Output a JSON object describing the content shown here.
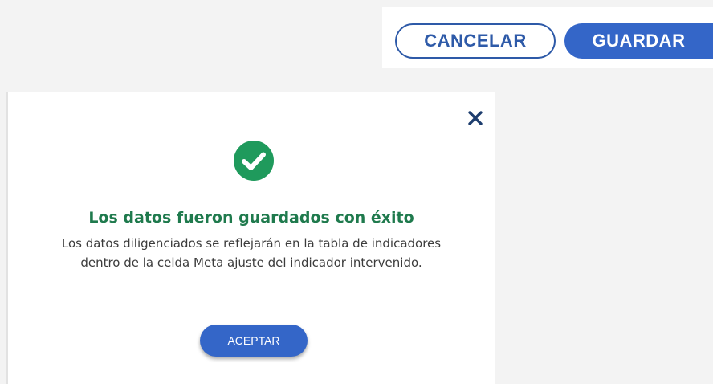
{
  "action_bar": {
    "cancel_label": "CANCELAR",
    "save_label": "GUARDAR"
  },
  "success_modal": {
    "close_icon": "close-icon",
    "status_icon": "check-circle-icon",
    "title": "Los datos fueron guardados con éxito",
    "message": "Los datos diligenciados se reflejarán en la tabla de indicadores dentro de la celda Meta ajuste del indicador intervenido.",
    "accept_label": "ACEPTAR"
  },
  "colors": {
    "primary_blue": "#3466c8",
    "outline_blue": "#2e5aa8",
    "success_green": "#1f7a4d",
    "close_navy": "#1d3d6e"
  }
}
